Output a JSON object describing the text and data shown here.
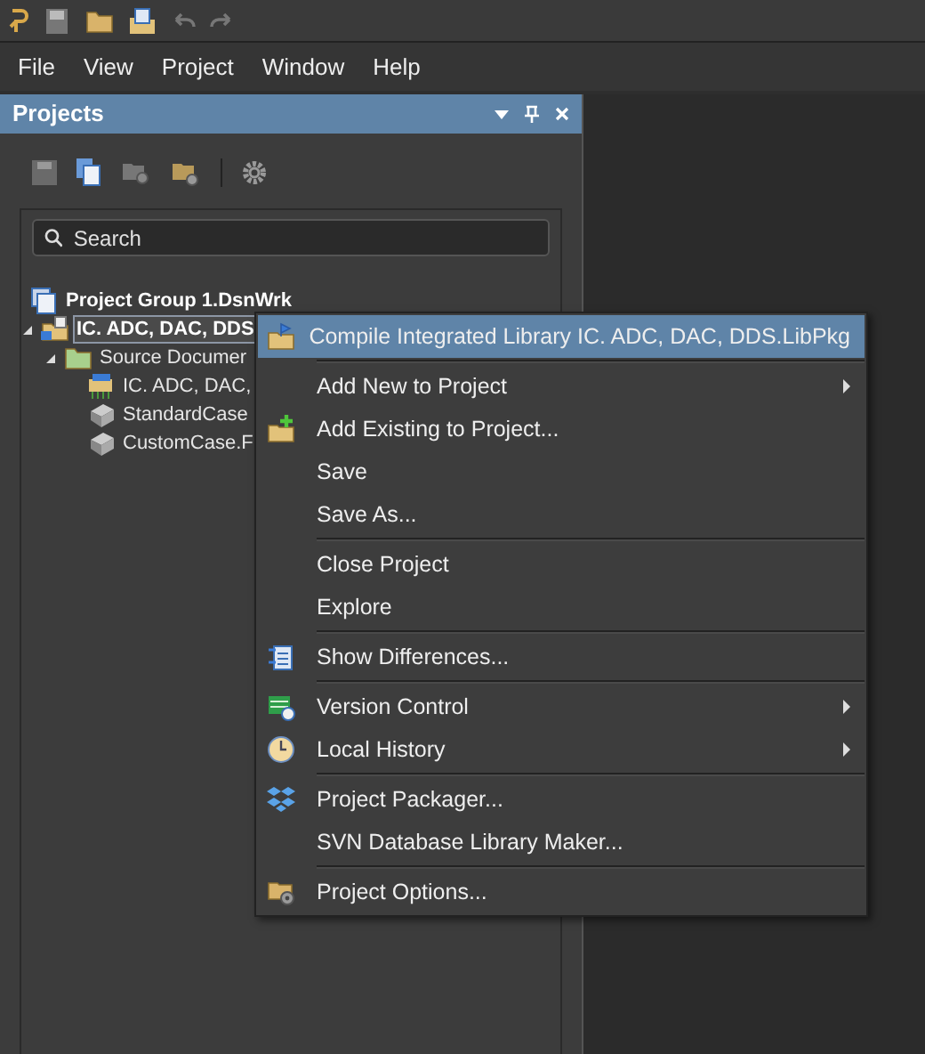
{
  "menubar": [
    "File",
    "View",
    "Project",
    "Window",
    "Help"
  ],
  "panel": {
    "title": "Projects",
    "search": {
      "placeholder": "Search"
    },
    "tree": [
      {
        "label": "Project Group 1.DsnWrk",
        "selected": false,
        "expanded": true,
        "children": [
          {
            "label": "IC. ADC, DAC, DDS",
            "selected": true,
            "expanded": true,
            "children": [
              {
                "label": "Source Documer",
                "selected": false,
                "expanded": true,
                "children": [
                  {
                    "label": "IC. ADC, DAC,",
                    "selected": false
                  },
                  {
                    "label": "StandardCase",
                    "selected": false
                  },
                  {
                    "label": "CustomCase.F",
                    "selected": false
                  }
                ]
              }
            ]
          }
        ]
      }
    ]
  },
  "context_menu": {
    "groups": [
      [
        {
          "label": "Compile Integrated Library IC. ADC, DAC, DDS.LibPkg",
          "selected": true,
          "submenu": false
        }
      ],
      [
        {
          "label": "Add New to Project",
          "selected": false,
          "submenu": true
        },
        {
          "label": "Add Existing to Project...",
          "selected": false,
          "submenu": false
        },
        {
          "label": "Save",
          "selected": false,
          "submenu": false
        },
        {
          "label": "Save As...",
          "selected": false,
          "submenu": false
        }
      ],
      [
        {
          "label": "Close Project",
          "selected": false,
          "submenu": false
        },
        {
          "label": "Explore",
          "selected": false,
          "submenu": false
        }
      ],
      [
        {
          "label": "Show Differences...",
          "selected": false,
          "submenu": false
        }
      ],
      [
        {
          "label": "Version Control",
          "selected": false,
          "submenu": true
        },
        {
          "label": "Local History",
          "selected": false,
          "submenu": true
        }
      ],
      [
        {
          "label": "Project Packager...",
          "selected": false,
          "submenu": false
        },
        {
          "label": "SVN Database Library Maker...",
          "selected": false,
          "submenu": false
        }
      ],
      [
        {
          "label": "Project Options...",
          "selected": false,
          "submenu": false
        }
      ]
    ]
  }
}
